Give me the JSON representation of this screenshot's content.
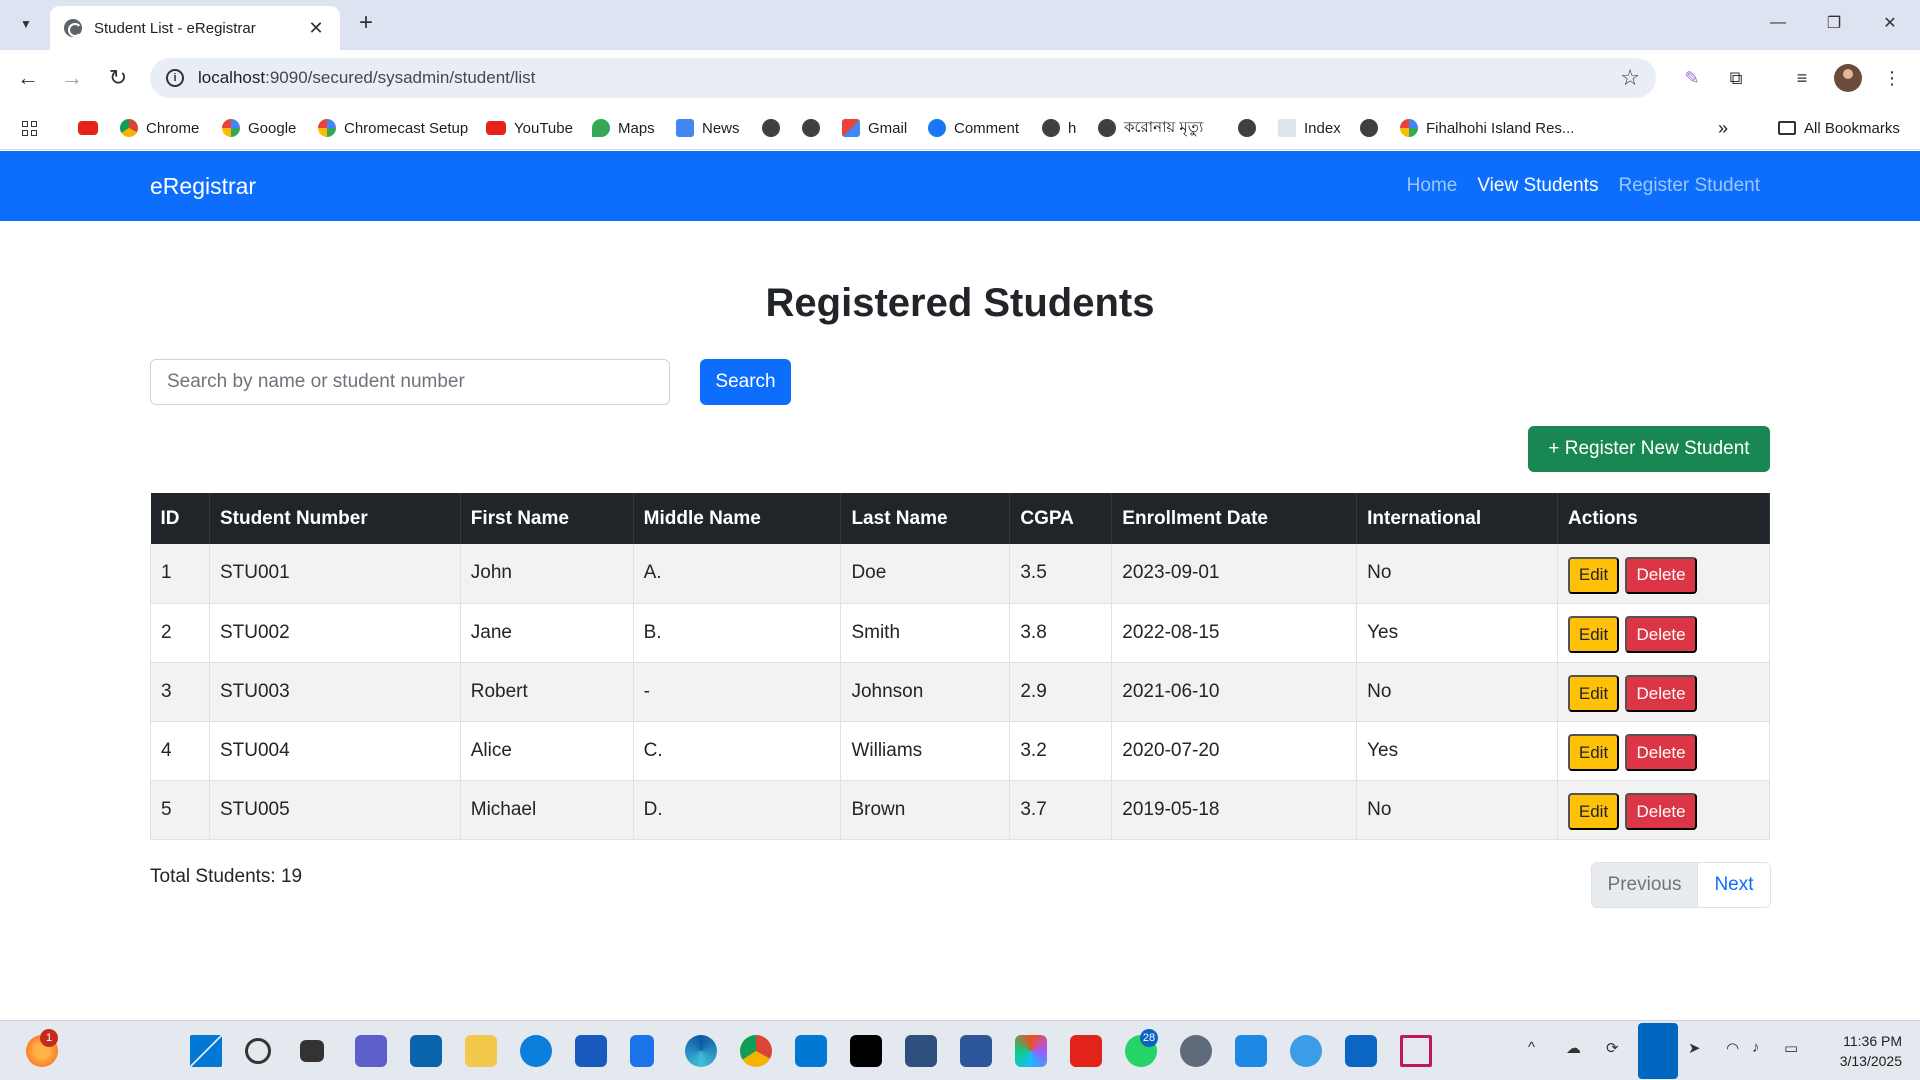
{
  "browser": {
    "tab_title": "Student List - eRegistrar",
    "url_host": "localhost",
    "url_path": ":9090/secured/sysadmin/student/list",
    "bookmarks": [
      "Chrome",
      "Google",
      "Chromecast Setup",
      "YouTube",
      "Maps",
      "News",
      "Gmail",
      "Comment",
      "h",
      "করোনায় মৃত্যু",
      "Index",
      "Fihalhohi Island Res..."
    ],
    "all_bookmarks": "All Bookmarks"
  },
  "navbar": {
    "brand": "eRegistrar",
    "links": [
      {
        "label": "Home",
        "active": false
      },
      {
        "label": "View Students",
        "active": true
      },
      {
        "label": "Register Student",
        "active": false
      }
    ]
  },
  "main": {
    "title": "Registered Students",
    "search_placeholder": "Search by name or student number",
    "search_button": "Search",
    "register_button": "+ Register New Student",
    "table": {
      "headers": [
        "ID",
        "Student Number",
        "First Name",
        "Middle Name",
        "Last Name",
        "CGPA",
        "Enrollment Date",
        "International",
        "Actions"
      ],
      "rows": [
        [
          "1",
          "STU001",
          "John",
          "A.",
          "Doe",
          "3.5",
          "2023-09-01",
          "No"
        ],
        [
          "2",
          "STU002",
          "Jane",
          "B.",
          "Smith",
          "3.8",
          "2022-08-15",
          "Yes"
        ],
        [
          "3",
          "STU003",
          "Robert",
          "-",
          "Johnson",
          "2.9",
          "2021-06-10",
          "No"
        ],
        [
          "4",
          "STU004",
          "Alice",
          "C.",
          "Williams",
          "3.2",
          "2020-07-20",
          "Yes"
        ],
        [
          "5",
          "STU005",
          "Michael",
          "D.",
          "Brown",
          "3.7",
          "2019-05-18",
          "No"
        ]
      ],
      "edit_label": "Edit",
      "delete_label": "Delete"
    },
    "total": "Total Students: 19",
    "pagination": {
      "previous": "Previous",
      "next": "Next"
    }
  },
  "taskbar": {
    "time": "11:36 PM",
    "date": "3/13/2025",
    "whatsapp_badge": "28",
    "notification_badge": "1"
  },
  "colors": {
    "primary": "#0d6efd",
    "success": "#198754",
    "warning": "#ffc107",
    "danger": "#dc3545",
    "dark": "#212529"
  }
}
